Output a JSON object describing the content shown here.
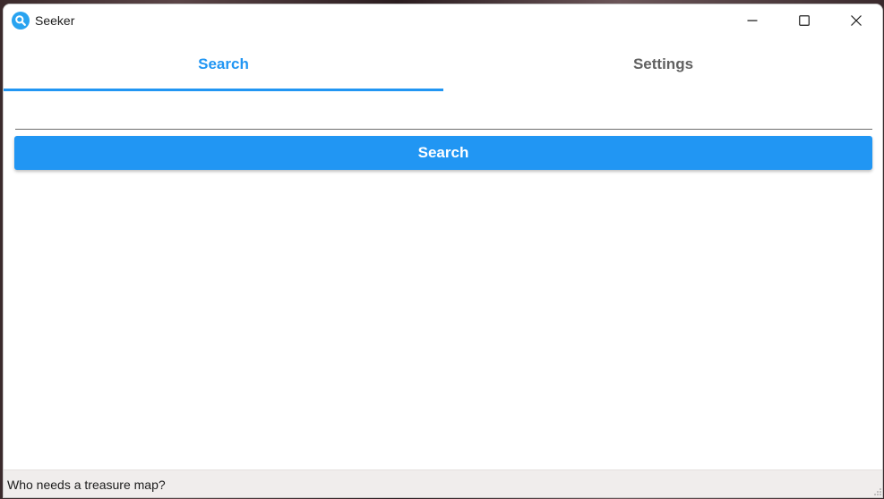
{
  "window": {
    "title": "Seeker",
    "icon": "magnifier-app-icon",
    "accent_color": "#2196f3"
  },
  "tabs": [
    {
      "label": "Search",
      "selected": true
    },
    {
      "label": "Settings",
      "selected": false
    }
  ],
  "search": {
    "value": "",
    "placeholder": "",
    "button_label": "Search"
  },
  "status_bar": {
    "text": "Who needs a treasure map?"
  }
}
